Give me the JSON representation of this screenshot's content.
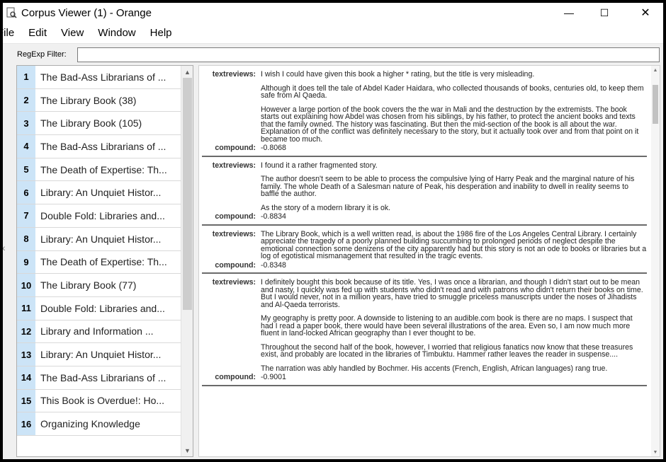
{
  "window": {
    "title": "Corpus Viewer (1) - Orange",
    "icon": "document-search-icon",
    "controls": {
      "minimize": "—",
      "maximize": "☐",
      "close": "✕"
    }
  },
  "menu": [
    "File",
    "Edit",
    "View",
    "Window",
    "Help"
  ],
  "filter": {
    "label": "RegExp Filter:",
    "value": ""
  },
  "list": {
    "items": [
      {
        "num": "1",
        "title": "The Bad-Ass Librarians of ..."
      },
      {
        "num": "2",
        "title": "The Library Book (38)"
      },
      {
        "num": "3",
        "title": "The Library Book (105)"
      },
      {
        "num": "4",
        "title": "The Bad-Ass Librarians of ..."
      },
      {
        "num": "5",
        "title": "The Death of Expertise: Th..."
      },
      {
        "num": "6",
        "title": "Library: An Unquiet Histor..."
      },
      {
        "num": "7",
        "title": "Double Fold: Libraries and..."
      },
      {
        "num": "8",
        "title": "Library: An Unquiet Histor..."
      },
      {
        "num": "9",
        "title": "The Death of Expertise: Th..."
      },
      {
        "num": "10",
        "title": "The Library Book (77)"
      },
      {
        "num": "11",
        "title": "Double Fold: Libraries and..."
      },
      {
        "num": "12",
        "title": "Library and Information ..."
      },
      {
        "num": "13",
        "title": "Library: An Unquiet Histor..."
      },
      {
        "num": "14",
        "title": "The Bad-Ass Librarians of ..."
      },
      {
        "num": "15",
        "title": "This Book is Overdue!: Ho..."
      },
      {
        "num": "16",
        "title": "Organizing Knowledge"
      }
    ]
  },
  "docs": {
    "labels": {
      "text": "textreviews:",
      "compound": "compound:"
    },
    "items": [
      {
        "paragraphs": [
          "I wish I could have given this book a higher * rating, but the title is very misleading.",
          "Although it does tell the tale of Abdel Kader Haidara, who collected thousands of books, centuries old, to keep them safe from Al Qaeda.",
          "However a large portion of the book covers the the war in Mali and the destruction by the extremists. The book starts out explaining how Abdel was chosen from his siblings, by his father, to protect the ancient books and texts that the family owned. The history was fascinating. But then the mid-section of the book is all about the war. Explanation of of the conflict was definitely necessary to the story, but it actually took over and from that point on it became too much."
        ],
        "compound": "-0.8068"
      },
      {
        "paragraphs": [
          "I found it a rather fragmented story.",
          "The author doesn't seem to be able to process the compulsive lying of Harry Peak and the marginal nature of his family. The whole Death of a Salesman nature of Peak, his desperation and inability to dwell in reality seems to baffle the author.",
          "As the story of a modern library it is ok."
        ],
        "compound": "-0.8834"
      },
      {
        "paragraphs": [
          "The Library Book, which is a well written read, is about the 1986 fire of the Los Angeles Central Library. I certainly appreciate the tragedy of a poorly planned building succumbing to prolonged periods of neglect despite the emotional connection some denizens of the city apparently had but this story is not an ode to books or libraries but a log of egotistical mismanagement that resulted in the tragic events."
        ],
        "compound": "-0.8348"
      },
      {
        "paragraphs": [
          "I definitely bought this book because of its title. Yes, I was once a librarian, and though I didn't start out to be mean and nasty, I quickly was fed up with students who didn't read and with patrons who didn't return their books on time. But I would never, not in a million years, have tried to smuggle priceless manuscripts under the noses of Jihadists and Al-Qaeda terrorists.",
          "My geography is pretty poor. A downside to listening to an audible.com book is there are no maps. I suspect that had I read a paper book, there would have been several illustrations of the area. Even so, I am now much more fluent in land-locked African geography than I ever thought to be.",
          "Throughout the second half of the book, however, I worried that religious fanatics now know that these treasures exist, and probably are located in the libraries of Timbuktu. Hammer rather leaves the reader in suspense....",
          "The narration was ably handled by Bochmer. His accents (French, English, African languages) rang true."
        ],
        "compound": "-0.9001"
      }
    ]
  }
}
